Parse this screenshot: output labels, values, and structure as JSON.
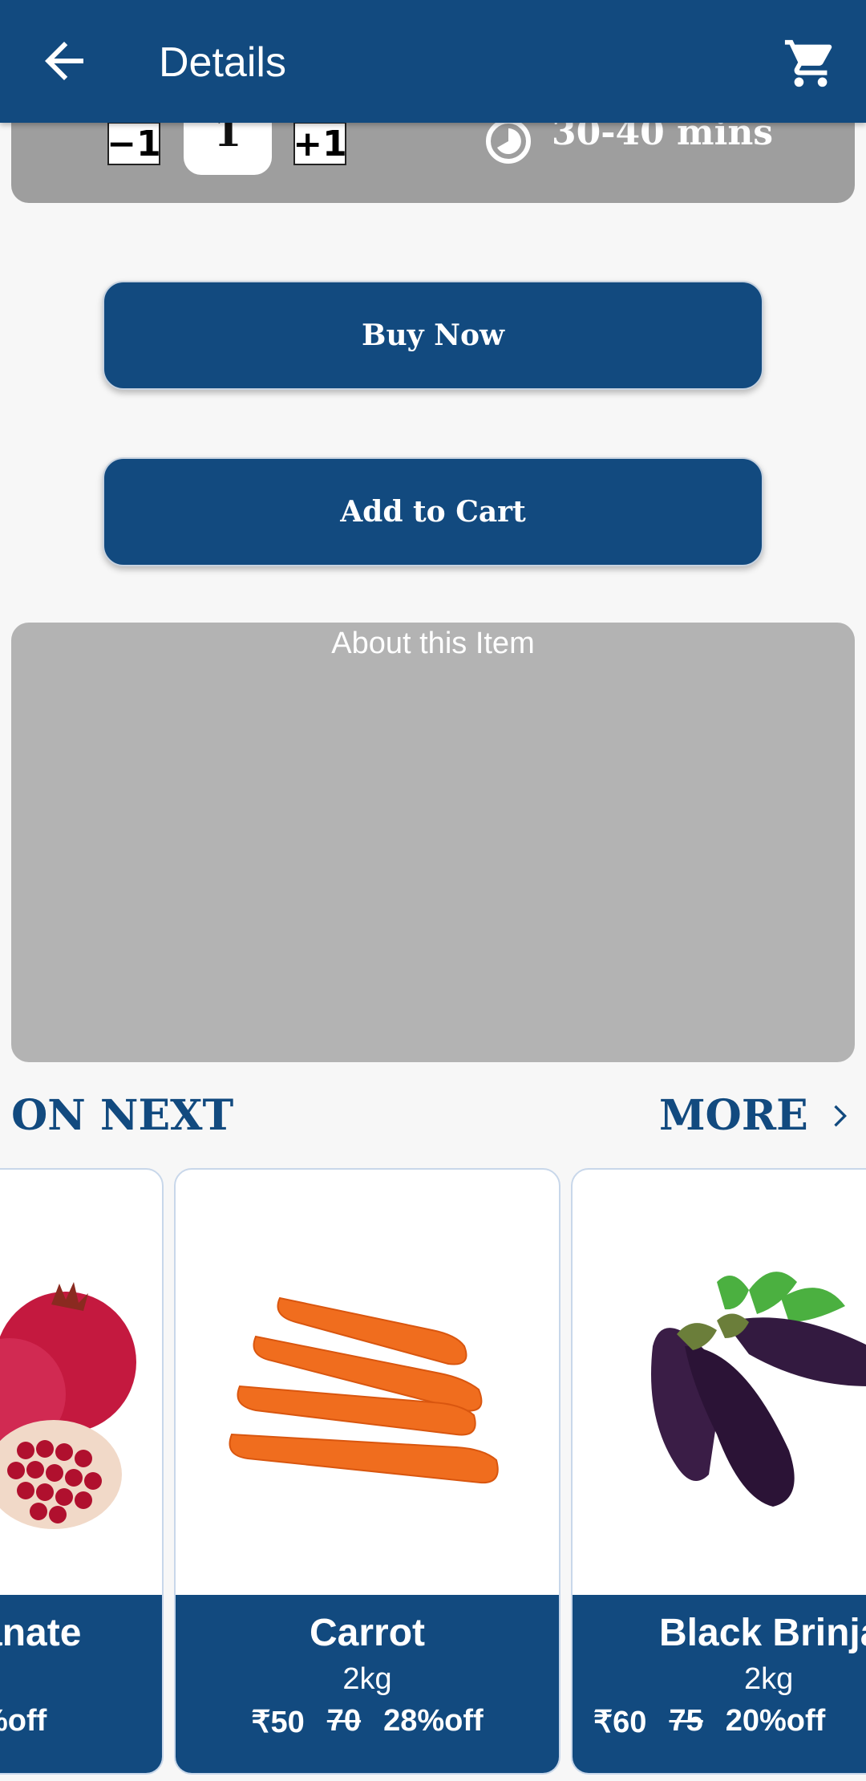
{
  "header": {
    "title": "Details"
  },
  "quantity": {
    "decrement": "−1",
    "value": "1",
    "increment": "+1"
  },
  "delivery": {
    "time": "30-40 mins"
  },
  "actions": {
    "buy_now": "Buy Now",
    "add_to_cart": "Add to Cart"
  },
  "about": {
    "title": "About this Item"
  },
  "section": {
    "title": "ON NEXT",
    "more": "MORE"
  },
  "products": [
    {
      "name": "anate",
      "weight": "",
      "price": "",
      "old_price": "",
      "discount": "%off"
    },
    {
      "name": "Carrot",
      "weight": "2kg",
      "price": "₹50",
      "old_price": "70",
      "discount": "28%off"
    },
    {
      "name": "Black Brinja",
      "weight": "2kg",
      "price": "₹60",
      "old_price": "75",
      "discount": "20%off"
    }
  ],
  "colors": {
    "primary": "#124a7f",
    "card_gray": "#9e9e9e",
    "about_gray": "#b3b3b3",
    "background": "#f7f7f7"
  },
  "icons": {
    "back": "arrow-left-icon",
    "cart": "cart-icon",
    "timer": "timer-icon",
    "more": "chevron-right-icon"
  }
}
